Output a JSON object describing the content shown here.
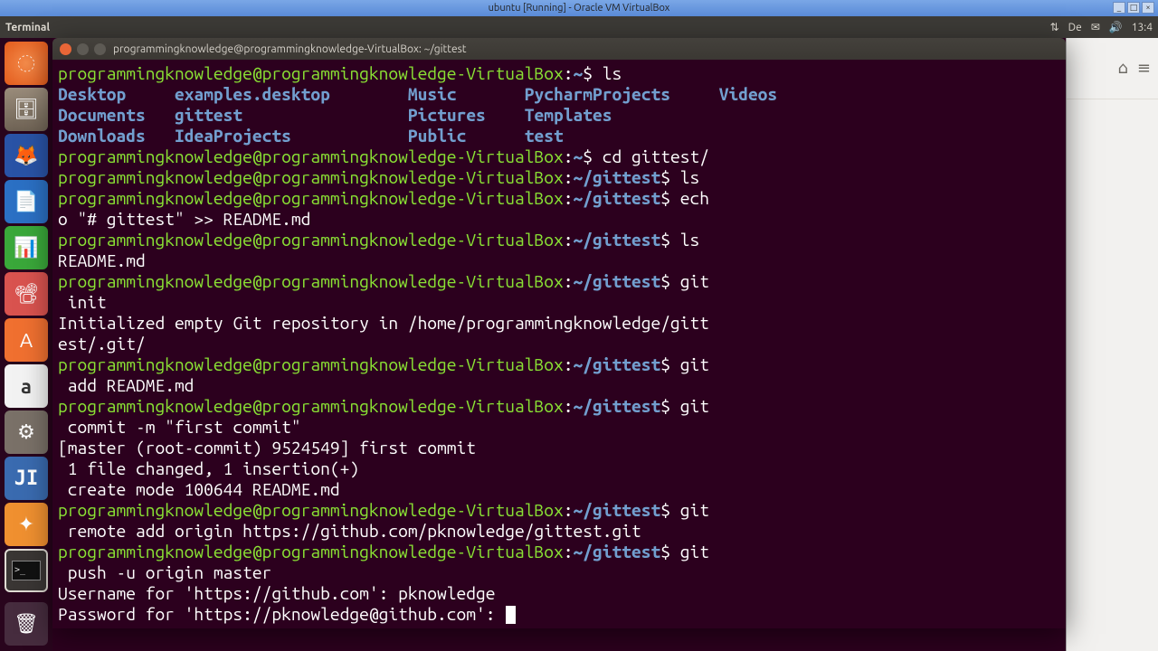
{
  "virtualbox": {
    "title": "ubuntu [Running] - Oracle VM VirtualBox"
  },
  "top_panel": {
    "active_app": "Terminal",
    "keyboard": "De",
    "clock": "13:4"
  },
  "launcher": {
    "items": [
      {
        "name": "ubuntu-dash",
        "glyph": "◌"
      },
      {
        "name": "files",
        "glyph": "🗄"
      },
      {
        "name": "firefox",
        "glyph": "🦊"
      },
      {
        "name": "libreoffice-writer",
        "glyph": "📄"
      },
      {
        "name": "libreoffice-calc",
        "glyph": "📊"
      },
      {
        "name": "libreoffice-impress",
        "glyph": "📽"
      },
      {
        "name": "ubuntu-software",
        "glyph": "A"
      },
      {
        "name": "amazon",
        "glyph": "a"
      },
      {
        "name": "system-settings",
        "glyph": "⚙"
      },
      {
        "name": "jetbrains",
        "glyph": "JI"
      },
      {
        "name": "jetbrains-2",
        "glyph": "✦"
      },
      {
        "name": "terminal",
        "glyph": ">_"
      }
    ],
    "trash_glyph": "🗑"
  },
  "terminal": {
    "window_title": "programmingknowledge@programmingknowledge-VirtualBox: ~/gittest",
    "user": "programmingknowledge",
    "host": "programmingknowledge-VirtualBox",
    "home_path": "~",
    "path": "~/gittest",
    "ls_dirs_row1": [
      "Desktop",
      "examples.desktop",
      "Music",
      "PycharmProjects",
      "Videos"
    ],
    "ls_dirs_row2": [
      "Documents",
      "gittest",
      "Pictures",
      "Templates"
    ],
    "ls_dirs_row3": [
      "Downloads",
      "IdeaProjects",
      "Public",
      "test"
    ],
    "cmd_ls": "ls",
    "cmd_cd": "cd gittest/",
    "cmd_ls2": "ls",
    "cmd_echo_a": "ech",
    "cmd_echo_b": "o \"# gittest\" >> README.md",
    "cmd_ls3": "ls",
    "ls3_out": "README.md",
    "cmd_git_init_a": "git",
    "cmd_git_init_b": " init",
    "init_out_a": "Initialized empty Git repository in /home/programmingknowledge/gitt",
    "init_out_b": "est/.git/",
    "cmd_git_add_a": "git",
    "cmd_git_add_b": " add README.md",
    "cmd_git_commit_a": "git",
    "cmd_git_commit_b": " commit -m \"first commit\"",
    "commit_out_1": "[master (root-commit) 9524549] first commit",
    "commit_out_2": " 1 file changed, 1 insertion(+)",
    "commit_out_3": " create mode 100644 README.md",
    "cmd_git_remote_a": "git",
    "cmd_git_remote_b": " remote add origin https://github.com/pknowledge/gittest.git",
    "cmd_git_push_a": "git",
    "cmd_git_push_b": " push -u origin master",
    "username_prompt": "Username for 'https://github.com': ",
    "username_value": "pknowledge",
    "password_prompt": "Password for 'https://pknowledge@github.com': "
  },
  "right_panel": {
    "home_glyph": "⌂",
    "menu_glyph": "≡"
  }
}
